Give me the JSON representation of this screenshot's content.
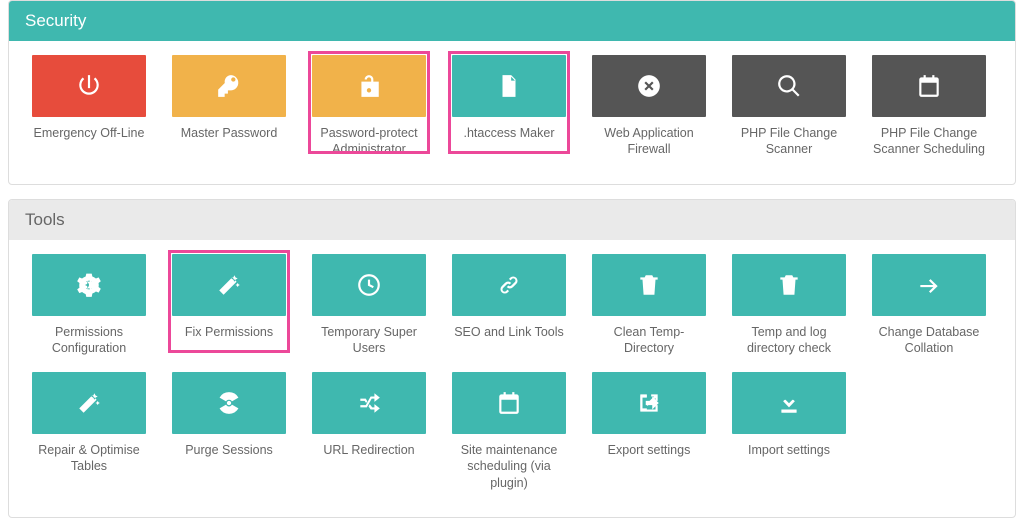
{
  "security": {
    "title": "Security",
    "items": [
      {
        "label": "Emergency Off-Line",
        "icon": "power",
        "color": "red",
        "highlight": false
      },
      {
        "label": "Master Password",
        "icon": "key",
        "color": "orange",
        "highlight": false
      },
      {
        "label": "Password-protect Administrator",
        "icon": "unlock",
        "color": "orange",
        "highlight": true
      },
      {
        "label": ".htaccess Maker",
        "icon": "file",
        "color": "teal",
        "highlight": true
      },
      {
        "label": "Web Application Firewall",
        "icon": "xcircle",
        "color": "dark",
        "highlight": false
      },
      {
        "label": "PHP File Change Scanner",
        "icon": "search",
        "color": "dark",
        "highlight": false
      },
      {
        "label": "PHP File Change Scanner Scheduling",
        "icon": "calendar",
        "color": "dark",
        "highlight": false
      }
    ]
  },
  "tools": {
    "title": "Tools",
    "items": [
      {
        "label": "Permissions Configuration",
        "icon": "gear",
        "highlight": false
      },
      {
        "label": "Fix Permissions",
        "icon": "wand",
        "highlight": true
      },
      {
        "label": "Temporary Super Users",
        "icon": "clock",
        "highlight": false
      },
      {
        "label": "SEO and Link Tools",
        "icon": "link",
        "highlight": false
      },
      {
        "label": "Clean Temp-Directory",
        "icon": "trash",
        "highlight": false
      },
      {
        "label": "Temp and log directory check",
        "icon": "trash",
        "highlight": false
      },
      {
        "label": "Change Database Collation",
        "icon": "arrow",
        "highlight": false
      },
      {
        "label": "Repair & Optimise Tables",
        "icon": "wand",
        "highlight": false
      },
      {
        "label": "Purge Sessions",
        "icon": "radiation",
        "highlight": false
      },
      {
        "label": "URL Redirection",
        "icon": "shuffle",
        "highlight": false
      },
      {
        "label": "Site maintenance scheduling (via plugin)",
        "icon": "calendar",
        "highlight": false
      },
      {
        "label": "Export settings",
        "icon": "export",
        "highlight": false
      },
      {
        "label": "Import settings",
        "icon": "import",
        "highlight": false
      }
    ]
  }
}
